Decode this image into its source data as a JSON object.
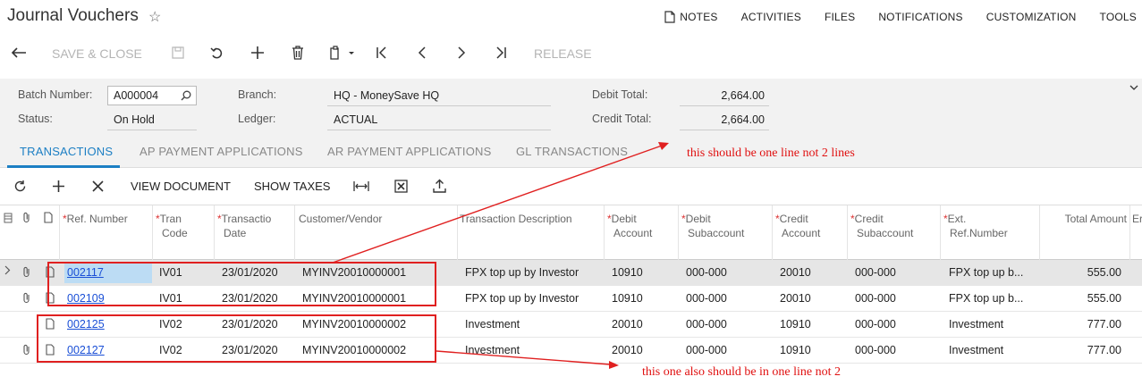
{
  "header": {
    "title": "Journal Vouchers",
    "nav": [
      "NOTES",
      "ACTIVITIES",
      "FILES",
      "NOTIFICATIONS",
      "CUSTOMIZATION",
      "TOOLS"
    ]
  },
  "toolbar": {
    "save_close": "SAVE & CLOSE",
    "release": "RELEASE"
  },
  "form": {
    "batch_number_label": "Batch Number:",
    "batch_number": "A000004",
    "status_label": "Status:",
    "status": "On Hold",
    "branch_label": "Branch:",
    "branch": "HQ - MoneySave HQ",
    "ledger_label": "Ledger:",
    "ledger": "ACTUAL",
    "debit_total_label": "Debit Total:",
    "debit_total": "2,664.00",
    "credit_total_label": "Credit Total:",
    "credit_total": "2,664.00"
  },
  "tabs": [
    "TRANSACTIONS",
    "AP PAYMENT APPLICATIONS",
    "AR PAYMENT APPLICATIONS",
    "GL TRANSACTIONS"
  ],
  "grid_toolbar": {
    "view_document": "VIEW DOCUMENT",
    "show_taxes": "SHOW TAXES"
  },
  "columns": {
    "ref": [
      "Ref. Number"
    ],
    "tran_code": [
      "Tran",
      "Code"
    ],
    "tran_date": [
      "Transactio",
      "Date"
    ],
    "customer": [
      "Customer/Vendor"
    ],
    "desc": [
      "Transaction Description"
    ],
    "debit_acct": [
      "Debit",
      "Account"
    ],
    "debit_sub": [
      "Debit",
      "Subaccount"
    ],
    "credit_acct": [
      "Credit",
      "Account"
    ],
    "credit_sub": [
      "Credit",
      "Subaccount"
    ],
    "ext_ref": [
      "Ext.",
      "Ref.Number"
    ],
    "total": [
      "Total Amount"
    ],
    "extra": [
      "Er"
    ]
  },
  "rows": [
    {
      "ref": "002117",
      "code": "IV01",
      "date": "23/01/2020",
      "cust": "MYINV20010000001",
      "desc": "FPX top up by Investor",
      "da": "10910",
      "ds": "000-000",
      "ca": "20010",
      "cs": "000-000",
      "ext": "FPX top up b...",
      "total": "555.00"
    },
    {
      "ref": "002109",
      "code": "IV01",
      "date": "23/01/2020",
      "cust": "MYINV20010000001",
      "desc": "FPX top up by Investor",
      "da": "10910",
      "ds": "000-000",
      "ca": "20010",
      "cs": "000-000",
      "ext": "FPX top up b...",
      "total": "555.00"
    },
    {
      "ref": "002125",
      "code": "IV02",
      "date": "23/01/2020",
      "cust": "MYINV20010000002",
      "desc": "Investment",
      "da": "20010",
      "ds": "000-000",
      "ca": "10910",
      "cs": "000-000",
      "ext": "Investment",
      "total": "777.00"
    },
    {
      "ref": "002127",
      "code": "IV02",
      "date": "23/01/2020",
      "cust": "MYINV20010000002",
      "desc": "Investment",
      "da": "20010",
      "ds": "000-000",
      "ca": "10910",
      "cs": "000-000",
      "ext": "Investment",
      "total": "777.00"
    }
  ],
  "annotations": {
    "note1": "this should be one line not 2 lines",
    "note2": "this one also should be in one line not 2",
    "color": "#e02020"
  },
  "colors": {
    "accent": "#1c7fc4",
    "link": "#1a4fd6",
    "required": "#d33333"
  }
}
